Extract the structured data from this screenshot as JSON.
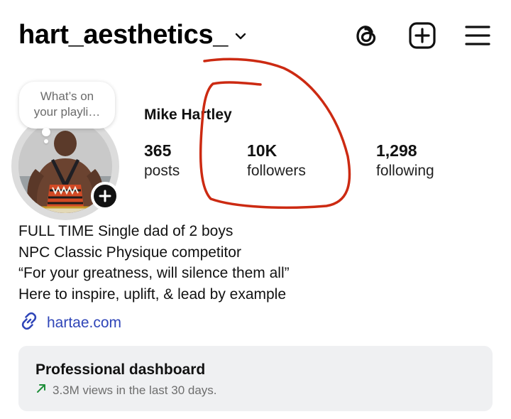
{
  "header": {
    "username": "hart_aesthetics_"
  },
  "note": {
    "text_line1": "What’s on",
    "text_line2": "your playli…"
  },
  "profile": {
    "display_name": "Mike Hartley"
  },
  "stats": [
    {
      "value": "365",
      "label": "posts"
    },
    {
      "value": "10K",
      "label": "followers"
    },
    {
      "value": "1,298",
      "label": "following"
    }
  ],
  "bio": {
    "lines": [
      "FULL TIME Single dad of 2 boys",
      "NPC Classic Physique competitor",
      "“For your greatness, will silence them all”",
      "Here to inspire, uplift, & lead by example"
    ]
  },
  "link": {
    "text": "hartae.com",
    "color": "#2f45b8"
  },
  "dashboard": {
    "title": "Professional dashboard",
    "subtitle": "3.3M views in the last 30 days.",
    "trend_color": "#1f8f3a"
  },
  "annotation": {
    "color": "#cc2a12"
  }
}
